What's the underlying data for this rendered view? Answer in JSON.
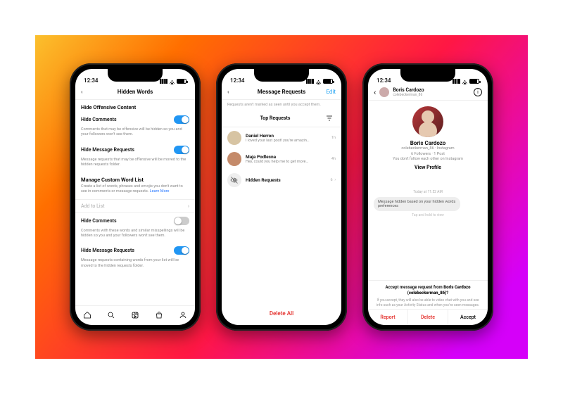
{
  "status": {
    "time": "12:34"
  },
  "phone1": {
    "title": "Hidden Words",
    "sectionA": "Hide Offensive Content",
    "hideComments": "Hide Comments",
    "hideCommentsHelp": "Comments that may be offensive will be hidden so you and your followers won't see them.",
    "hideMsgReq": "Hide Message Requests",
    "hideMsgReqHelp": "Message requests that may be offensive will be moved to the hidden requests folder.",
    "sectionB": "Manage Custom Word List",
    "manageHelp": "Create a list of words, phrases and emojis you don't want to see in comments or message requests.",
    "learnMore": "Learn More",
    "addToList": "Add to List",
    "hideComments2": "Hide Comments",
    "hideComments2Help": "Comments with these words and similar misspellings will be hidden so you and your followers won't see them.",
    "hideMsgReq2": "Hide Message Requests",
    "hideMsgReq2Help": "Message requests containing words from your list will be moved to the hidden requests folder."
  },
  "phone2": {
    "title": "Message Requests",
    "edit": "Edit",
    "note": "Requests aren't marked as seen until you accept them.",
    "tab": "Top Requests",
    "messages": [
      {
        "name": "Daniel Herron",
        "preview": "I loved your last post! you're amazin…",
        "time": "1h"
      },
      {
        "name": "Maja Podlesna",
        "preview": "Hey, could you help me to get more…",
        "time": "4h"
      }
    ],
    "hiddenRequests": "Hidden Requests",
    "hiddenCount": "6",
    "deleteAll": "Delete All"
  },
  "phone3": {
    "name": "Boris Cardozo",
    "username": "colebeckerman_86",
    "handleLine": "colebeckerman_86 · Instagram",
    "stats": "6 Followers · 1 Post",
    "mutual": "You don't follow each other on Instagram",
    "viewProfile": "View Profile",
    "timestamp": "Today at 11:52 AM",
    "hiddenMsg": "Message hidden based on your hidden words preferences",
    "tapHold": "Tap and hold to view",
    "acceptTitlePre": "Accept message request from ",
    "acceptTitleName": "Boris Cardozo (colebeckerman_86)",
    "acceptTitleQ": "?",
    "acceptHelp": "If you accept, they will also be able to video chat with you and see info such as your Activity Status and when you've seen messages.",
    "report": "Report",
    "delete": "Delete",
    "accept": "Accept"
  }
}
